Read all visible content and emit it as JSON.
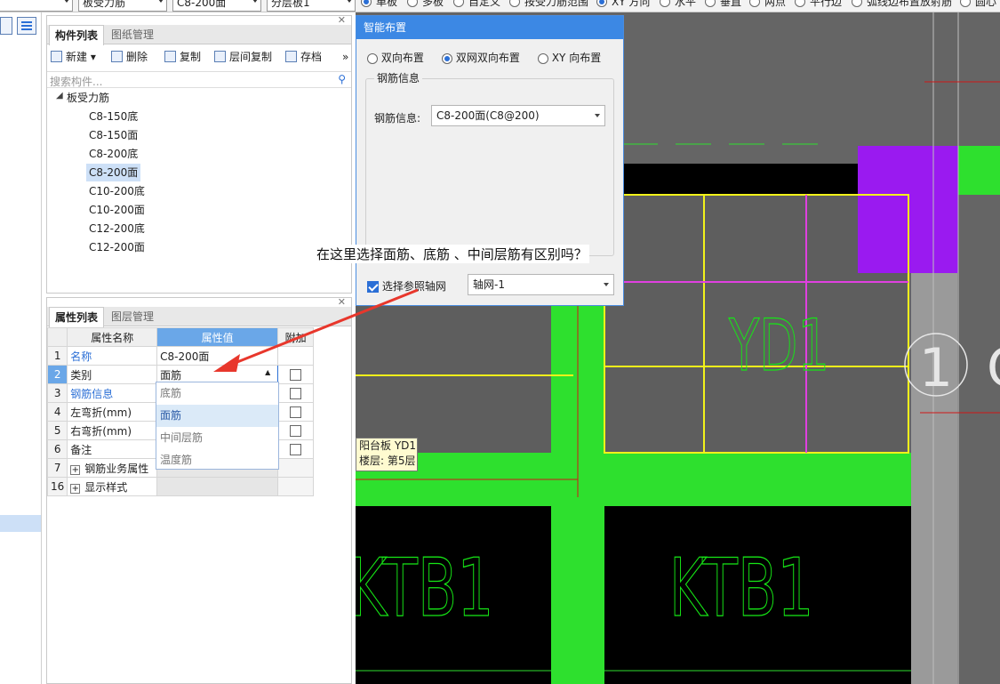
{
  "toolbar": {
    "combo1": "",
    "combo2": "板受力筋",
    "combo3": "C8-200面",
    "combo4": "分层板1",
    "radios": [
      "单板",
      "多板",
      "自定义",
      "按受力筋范围",
      "XY 方向",
      "水平",
      "垂直",
      "两点",
      "平行边",
      "弧线边布置放射筋",
      "圆心"
    ],
    "selected_radio": "单板"
  },
  "component_panel": {
    "tabs": [
      "构件列表",
      "图纸管理"
    ],
    "buttons": [
      "新建",
      "删除",
      "复制",
      "层间复制",
      "存档"
    ],
    "search_placeholder": "搜索构件...",
    "tree_root": "板受力筋",
    "items": [
      "C8-150底",
      "C8-150面",
      "C8-200底",
      "C8-200面",
      "C10-200底",
      "C10-200面",
      "C12-200底",
      "C12-200面"
    ],
    "selected_item": "C8-200面"
  },
  "property_panel": {
    "tabs": [
      "属性列表",
      "图层管理"
    ],
    "headers": [
      "属性名称",
      "属性值",
      "附加"
    ],
    "rows": [
      {
        "num": "1",
        "name": "名称",
        "value": "C8-200面",
        "link": true,
        "checkbox": false
      },
      {
        "num": "2",
        "name": "类别",
        "value": "面筋",
        "link": false,
        "checkbox": true
      },
      {
        "num": "3",
        "name": "钢筋信息",
        "value": "",
        "link": true,
        "checkbox": true
      },
      {
        "num": "4",
        "name": "左弯折(mm)",
        "value": "",
        "link": false,
        "checkbox": true
      },
      {
        "num": "5",
        "name": "右弯折(mm)",
        "value": "",
        "link": false,
        "checkbox": true
      },
      {
        "num": "6",
        "name": "备注",
        "value": "",
        "link": false,
        "checkbox": true
      },
      {
        "num": "7",
        "name": "钢筋业务属性",
        "value": "",
        "link": false,
        "checkbox": false,
        "expander": true
      },
      {
        "num": "16",
        "name": "显示样式",
        "value": "",
        "link": false,
        "checkbox": false,
        "expander": true
      }
    ],
    "dropdown_options": [
      "底筋",
      "面筋",
      "中间层筋",
      "温度筋"
    ],
    "dropdown_selected": "面筋"
  },
  "dialog": {
    "title": "智能布置",
    "options": [
      "双向布置",
      "双网双向布置",
      "XY 向布置"
    ],
    "selected_option": "双网双向布置",
    "group_label": "钢筋信息",
    "rebar_label": "钢筋信息:",
    "rebar_value": "C8-200面(C8@200)",
    "axis_check_label": "选择参照轴网",
    "axis_value": "轴网-1"
  },
  "annotation": {
    "question": "在这里选择面筋、底筋 、中间层筋有区别吗？",
    "arrow_color": "#e8372c"
  },
  "cad": {
    "labels": {
      "yd": "YD1",
      "ktb_left": "KTB1",
      "ktb_right": "KTB1",
      "circle_label": "1"
    },
    "tooltip_line1": "阳台板 YD1",
    "tooltip_line2": "楼层: 第5层",
    "colors": {
      "green": "#2ee02e",
      "purple": "#9a1af0",
      "yellow": "#f2f21a",
      "magenta": "#e040e0"
    }
  }
}
